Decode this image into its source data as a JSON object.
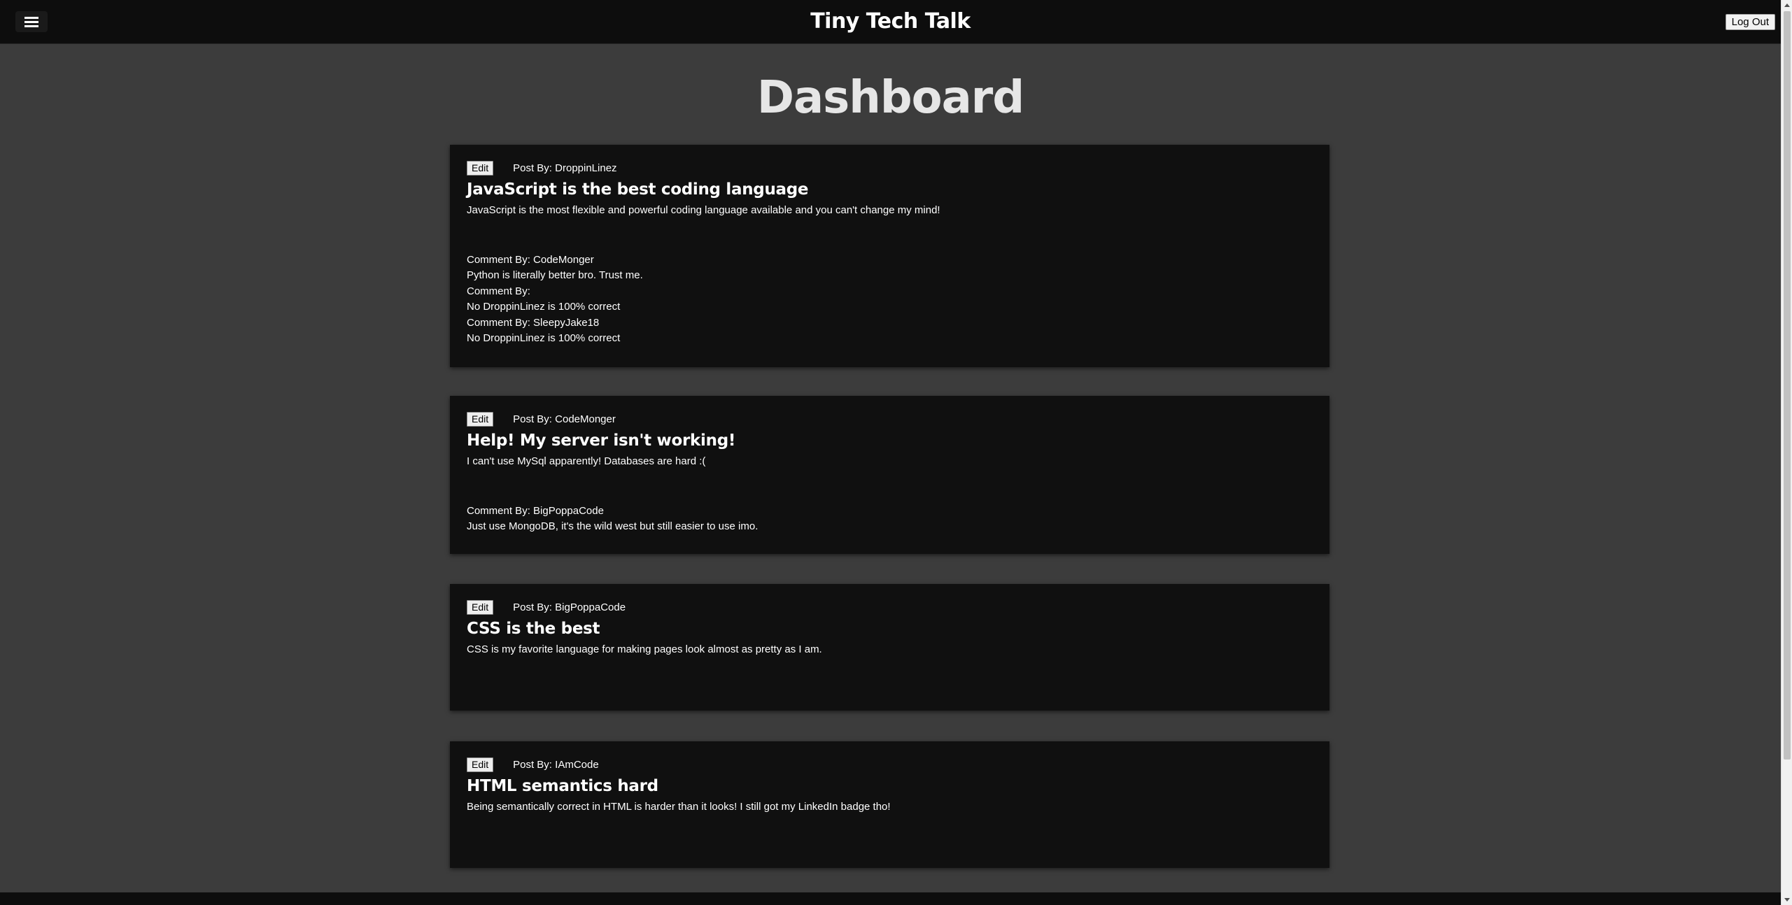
{
  "header": {
    "title": "Tiny Tech Talk",
    "logout_label": "Log Out"
  },
  "page": {
    "heading": "Dashboard"
  },
  "posts": [
    {
      "edit_label": "Edit",
      "author_line": "Post By: DroppinLinez",
      "title": "JavaScript is the best coding language",
      "body": "JavaScript is the most flexible and powerful coding language available and you can't change my mind!",
      "comments": [
        {
          "by": "Comment By: CodeMonger",
          "text": "Python is literally better bro. Trust me."
        },
        {
          "by": "Comment By:",
          "text": "No DroppinLinez is 100% correct"
        },
        {
          "by": "Comment By: SleepyJake18",
          "text": "No DroppinLinez is 100% correct"
        }
      ]
    },
    {
      "edit_label": "Edit",
      "author_line": "Post By: CodeMonger",
      "title": "Help! My server isn't working!",
      "body": "I can't use MySql apparently! Databases are hard :(",
      "comments": [
        {
          "by": "Comment By: BigPoppaCode",
          "text": "Just use MongoDB, it's the wild west but still easier to use imo."
        }
      ]
    },
    {
      "edit_label": "Edit",
      "author_line": "Post By: BigPoppaCode",
      "title": "CSS is the best",
      "body": "CSS is my favorite language for making pages look almost as pretty as I am.",
      "comments": []
    },
    {
      "edit_label": "Edit",
      "author_line": "Post By: IAmCode",
      "title": "HTML semantics hard",
      "body": "Being semantically correct in HTML is harder than it looks! I still got my LinkedIn badge tho!",
      "comments": []
    }
  ],
  "icons": {
    "menu": "hamburger-menu-icon"
  },
  "colors": {
    "background": "#3c3c3c",
    "topbar": "#0d0d0d",
    "card": "#101010",
    "text": "#ffffff",
    "heading": "#e6e6e6"
  }
}
